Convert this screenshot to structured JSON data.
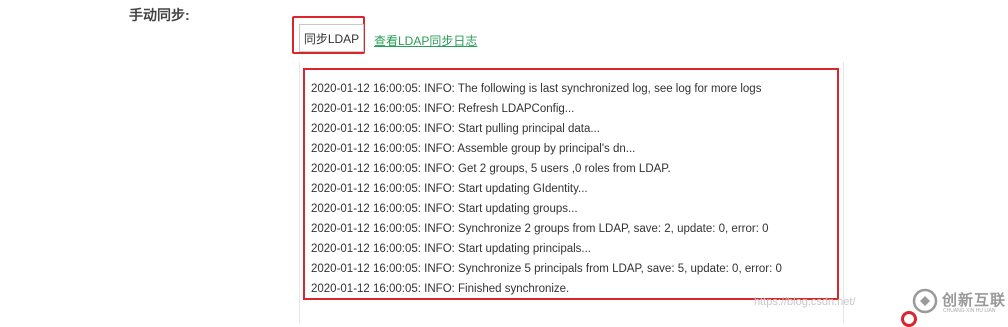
{
  "section": {
    "label": "手动同步:"
  },
  "actions": {
    "sync_button_label": "同步LDAP",
    "view_log_link": "查看LDAP同步日志"
  },
  "log": {
    "lines": [
      "2020-01-12 16:00:05: INFO: The following is last synchronized log, see log for more logs",
      "2020-01-12 16:00:05: INFO: Refresh LDAPConfig...",
      "2020-01-12 16:00:05: INFO: Start pulling principal data...",
      "2020-01-12 16:00:05: INFO: Assemble group by principal's dn...",
      "2020-01-12 16:00:05: INFO: Get 2 groups, 5 users ,0 roles from LDAP.",
      "2020-01-12 16:00:05: INFO: Start updating GIdentity...",
      "2020-01-12 16:00:05: INFO: Start updating groups...",
      "2020-01-12 16:00:05: INFO: Synchronize 2 groups from LDAP, save: 2, update: 0, error: 0",
      "2020-01-12 16:00:05: INFO: Start updating principals...",
      "2020-01-12 16:00:05: INFO: Synchronize 5 principals from LDAP, save: 5, update: 0, error: 0",
      "2020-01-12 16:00:05: INFO: Finished synchronize."
    ]
  },
  "watermark": {
    "url": "https://blog.csdn.net/",
    "brand_name": "创新互联",
    "brand_sub": "CHUANG XIN HU LIAN"
  },
  "colors": {
    "highlight": "#d9262c",
    "link": "#2a9d57"
  }
}
